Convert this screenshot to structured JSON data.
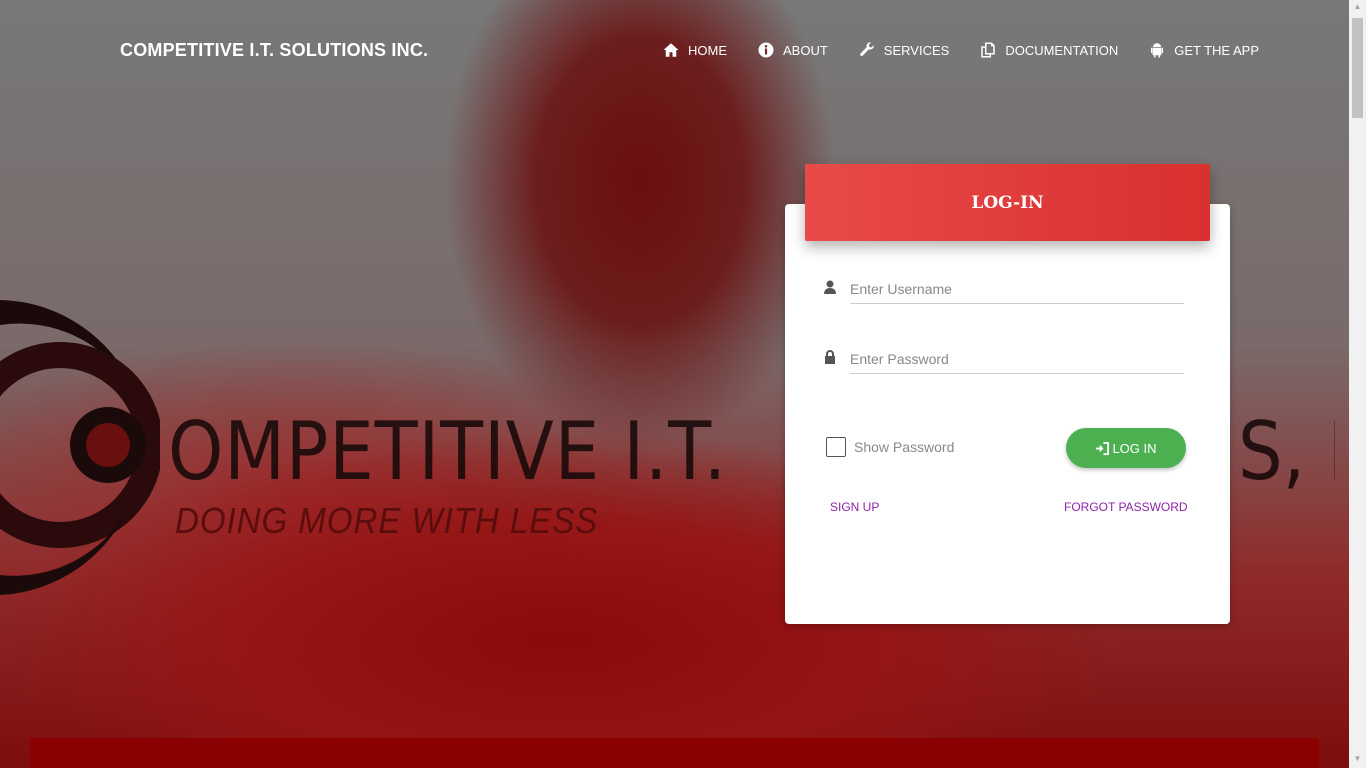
{
  "header": {
    "brand": "COMPETITIVE I.T. SOLUTIONS INC.",
    "nav": [
      {
        "label": "HOME",
        "icon": "home-icon"
      },
      {
        "label": "ABOUT",
        "icon": "info-icon"
      },
      {
        "label": "SERVICES",
        "icon": "wrench-icon"
      },
      {
        "label": "DOCUMENTATION",
        "icon": "documents-icon"
      },
      {
        "label": "GET THE APP",
        "icon": "android-icon"
      }
    ]
  },
  "hero": {
    "title": "OMPETITIVE I.T.",
    "title_tail": "S, I",
    "subtitle": "DOING MORE WITH LESS"
  },
  "login": {
    "title": "LOG-IN",
    "username_placeholder": "Enter Username",
    "password_placeholder": "Enter Password",
    "show_password_label": "Show Password",
    "login_button": "LOG IN",
    "sign_up": "SIGN UP",
    "forgot_password": "FORGOT PASSWORD"
  },
  "colors": {
    "header_red": "#e84a4a",
    "login_green": "#4caf50",
    "link_purple": "#8e24aa",
    "band_red": "#8b0000"
  }
}
